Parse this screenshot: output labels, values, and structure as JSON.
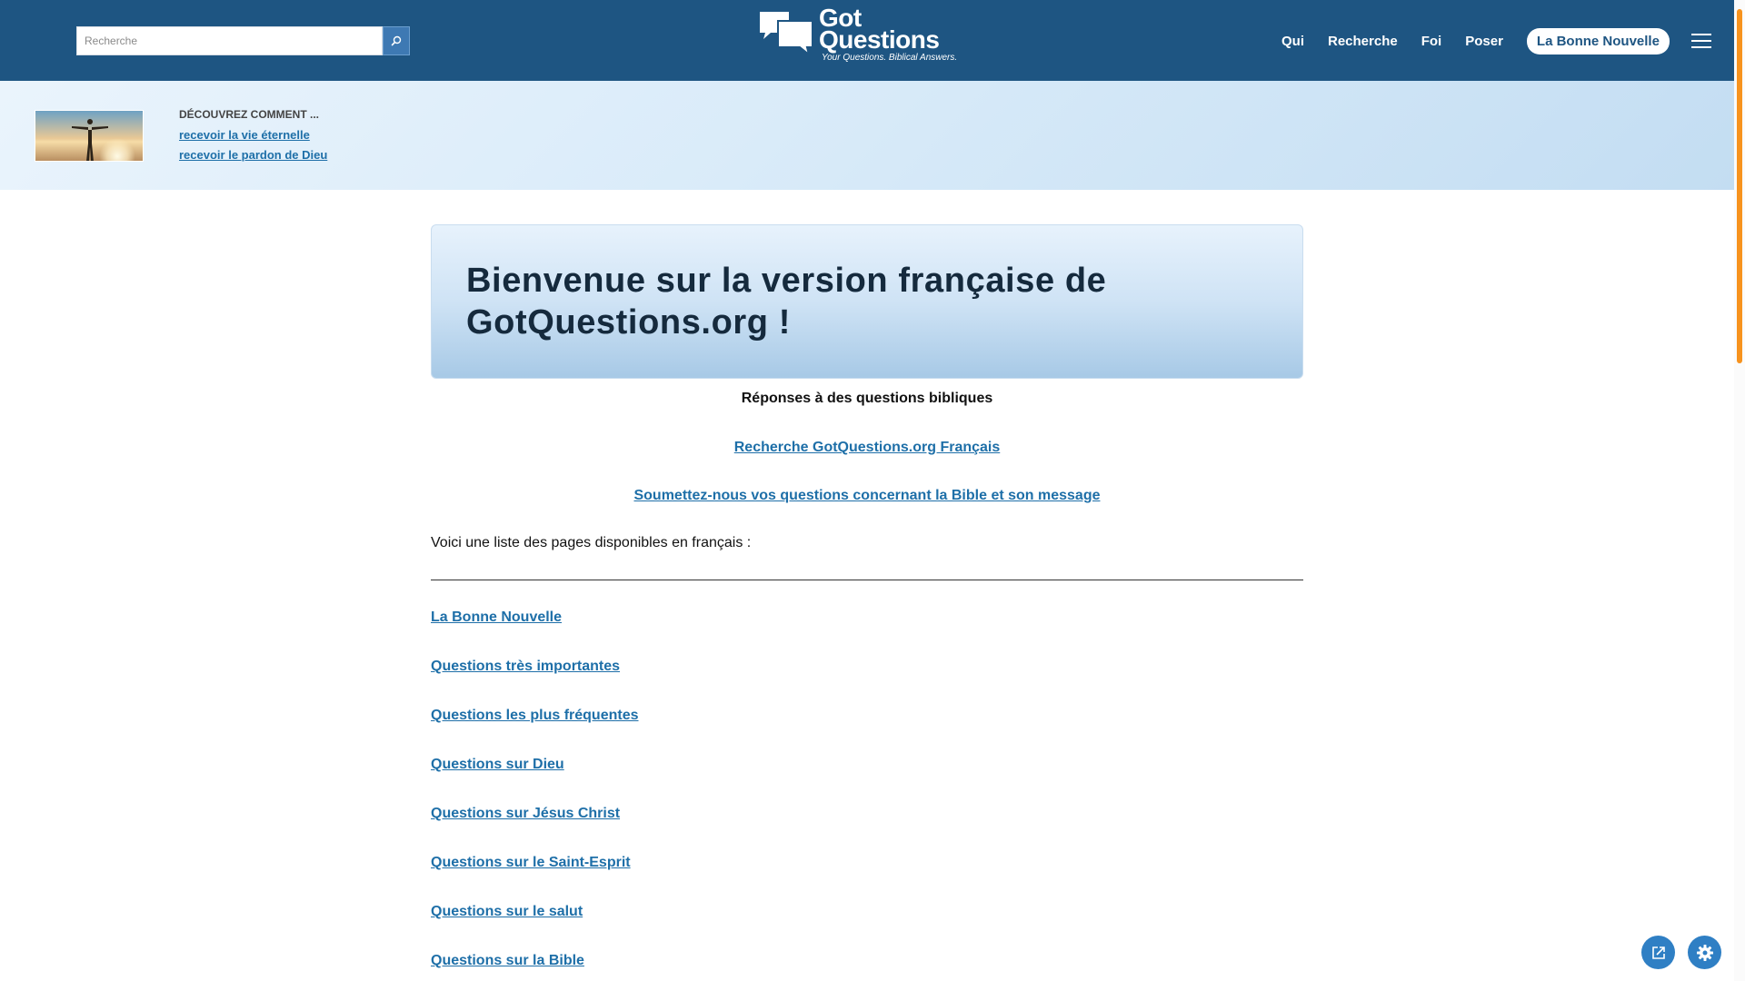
{
  "header": {
    "search_placeholder": "Recherche",
    "logo_line1": "Got",
    "logo_line2": "Questions",
    "logo_tagline": "Your Questions. Biblical Answers.",
    "nav": [
      "Qui",
      "Recherche",
      "Foi",
      "Poser"
    ],
    "cta_label": "La Bonne Nouvelle",
    "brand_color": "#1e5582"
  },
  "promo": {
    "heading": "DÉCOUVREZ COMMENT ...",
    "links": [
      "recevoir la vie éternelle",
      "recevoir le pardon de Dieu"
    ]
  },
  "main": {
    "hero_title": "Bienvenue sur la version française de GotQuestions.org !",
    "subtitle": "Réponses à des questions bibliques",
    "search_link": "Recherche GotQuestions.org Français",
    "submit_link": "Soumettez-nous vos questions concernant la Bible et son message",
    "intro": "Voici une liste des pages disponibles en français :",
    "page_links": [
      "La Bonne Nouvelle",
      "Questions très importantes",
      "Questions les plus fréquentes",
      "Questions sur Dieu",
      "Questions sur Jésus Christ",
      "Questions sur le Saint-Esprit",
      "Questions sur le salut",
      "Questions sur la Bible"
    ],
    "link_color": "#1e6fa8"
  },
  "floating": {
    "share_icon": "share-icon",
    "settings_icon": "gear-icon"
  }
}
